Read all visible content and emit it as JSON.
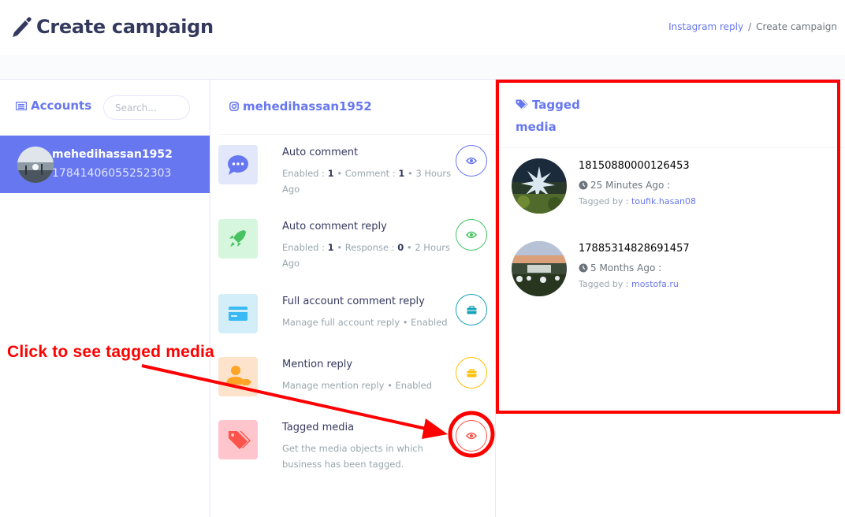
{
  "header": {
    "title": "Create campaign",
    "breadcrumb": {
      "link": "Instagram reply",
      "separator": "/",
      "current": "Create campaign"
    }
  },
  "accounts": {
    "heading": "Accounts",
    "search_placeholder": "Search...",
    "items": [
      {
        "name": "mehedihassan1952",
        "id": "17841406055252303",
        "selected": true
      }
    ]
  },
  "middle": {
    "heading": "mehedihassan1952",
    "features": [
      {
        "title": "Auto comment",
        "meta_parts": [
          "Enabled : ",
          "1",
          " • Comment : ",
          "1",
          " • ",
          "3 Hours Ago"
        ],
        "button_icon": "eye-icon",
        "color": "#6777ef",
        "tint": "#e3e7fc"
      },
      {
        "title": "Auto comment reply",
        "meta_parts": [
          "Enabled : ",
          "1",
          " • Response : ",
          "0",
          " • ",
          "2 Hours Ago"
        ],
        "button_icon": "eye-icon",
        "color": "#47c363",
        "tint": "#d6f7dd"
      },
      {
        "title": "Full account comment reply",
        "meta_text": "Manage full account reply • Enabled",
        "button_icon": "briefcase-icon",
        "color": "#3abaf4",
        "tint": "#d3eef9"
      },
      {
        "title": "Mention reply",
        "meta_text": "Manage mention reply • Enabled",
        "button_icon": "briefcase-icon",
        "color": "#ffa426",
        "tint": "#fde3cb"
      },
      {
        "title": "Tagged media",
        "meta_text": "Get the media objects in which business has been tagged.",
        "button_icon": "eye-icon",
        "color": "#fc544b",
        "tint": "#fec6cc"
      }
    ]
  },
  "tagged": {
    "heading_line1": "Tagged",
    "heading_line2": "media",
    "items": [
      {
        "id": "18150880000126453",
        "time": "25 Minutes Ago :",
        "tagged_by_label": "Tagged by : ",
        "user": "toufik.hasan08"
      },
      {
        "id": "17885314828691457",
        "time": "5 Months Ago :",
        "tagged_by_label": "Tagged by : ",
        "user": "mostofa.ru"
      }
    ]
  },
  "annotation": {
    "text": "Click to see tagged media",
    "color": "#ff0000"
  }
}
